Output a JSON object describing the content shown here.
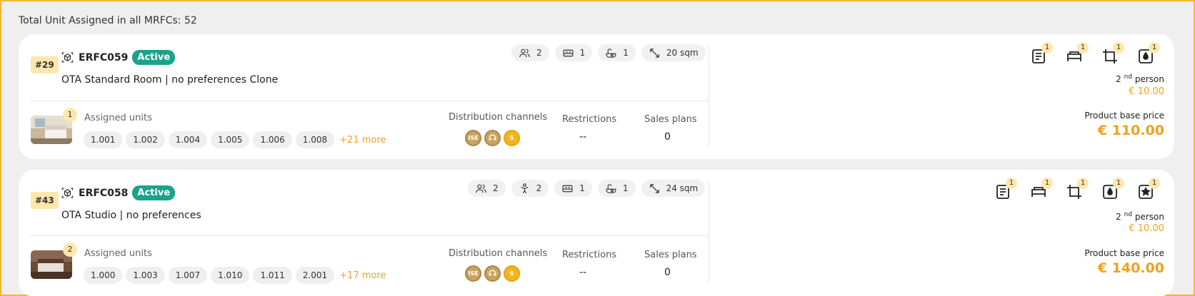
{
  "summary": {
    "text": "Total Unit Assigned in all MRFCs: 52"
  },
  "colors": {
    "accent": "#f0a020",
    "status_active": "#1aa28b",
    "badge": "#fde7ad"
  },
  "cards": [
    {
      "number": "#29",
      "code": "ERFC059",
      "status": "Active",
      "title": "OTA Standard Room | no preferences Clone",
      "chips": [
        {
          "icon": "persons-icon",
          "value": "2"
        },
        {
          "icon": "bed-icon",
          "value": "1"
        },
        {
          "icon": "bath-icon",
          "value": "1"
        },
        {
          "icon": "resize-icon",
          "value": "20 sqm"
        }
      ],
      "thumb_count": "1",
      "assigned_label": "Assigned units",
      "units": [
        "1.001",
        "1.002",
        "1.004",
        "1.005",
        "1.006",
        "1.008"
      ],
      "more": "+21 more",
      "distribution_label": "Distribution channels",
      "distribution_icons": [
        "ISE",
        "chat",
        "S"
      ],
      "restrictions_label": "Restrictions",
      "restrictions_value": "--",
      "sales_label": "Sales plans",
      "sales_value": "0",
      "facilities": [
        {
          "icon": "list-icon",
          "count": "1"
        },
        {
          "icon": "bed-icon",
          "count": "1"
        },
        {
          "icon": "crop-icon",
          "count": "1"
        },
        {
          "icon": "drop-icon",
          "count": "1"
        }
      ],
      "person_num": "2",
      "person_sup": "nd",
      "person_text": "person",
      "person_price": "€ 10.00",
      "base_label": "Product base price",
      "base_price": "€ 110.00"
    },
    {
      "number": "#43",
      "code": "ERFC058",
      "status": "Active",
      "title": "OTA Studio | no preferences",
      "chips": [
        {
          "icon": "persons-icon",
          "value": "2"
        },
        {
          "icon": "child-icon",
          "value": "2"
        },
        {
          "icon": "bed-icon",
          "value": "1"
        },
        {
          "icon": "bath-icon",
          "value": "1"
        },
        {
          "icon": "resize-icon",
          "value": "24 sqm"
        }
      ],
      "thumb_count": "2",
      "assigned_label": "Assigned units",
      "units": [
        "1.000",
        "1.003",
        "1.007",
        "1.010",
        "1.011",
        "2.001"
      ],
      "more": "+17 more",
      "distribution_label": "Distribution channels",
      "distribution_icons": [
        "ISE",
        "chat",
        "S"
      ],
      "restrictions_label": "Restrictions",
      "restrictions_value": "--",
      "sales_label": "Sales plans",
      "sales_value": "0",
      "facilities": [
        {
          "icon": "list-icon",
          "count": "1"
        },
        {
          "icon": "bed-icon",
          "count": "1"
        },
        {
          "icon": "crop-icon",
          "count": "1"
        },
        {
          "icon": "drop-icon",
          "count": "1"
        },
        {
          "icon": "star-icon",
          "count": "1"
        }
      ],
      "person_num": "2",
      "person_sup": "nd",
      "person_text": "person",
      "person_price": "€ 10.00",
      "base_label": "Product base price",
      "base_price": "€ 140.00"
    }
  ]
}
